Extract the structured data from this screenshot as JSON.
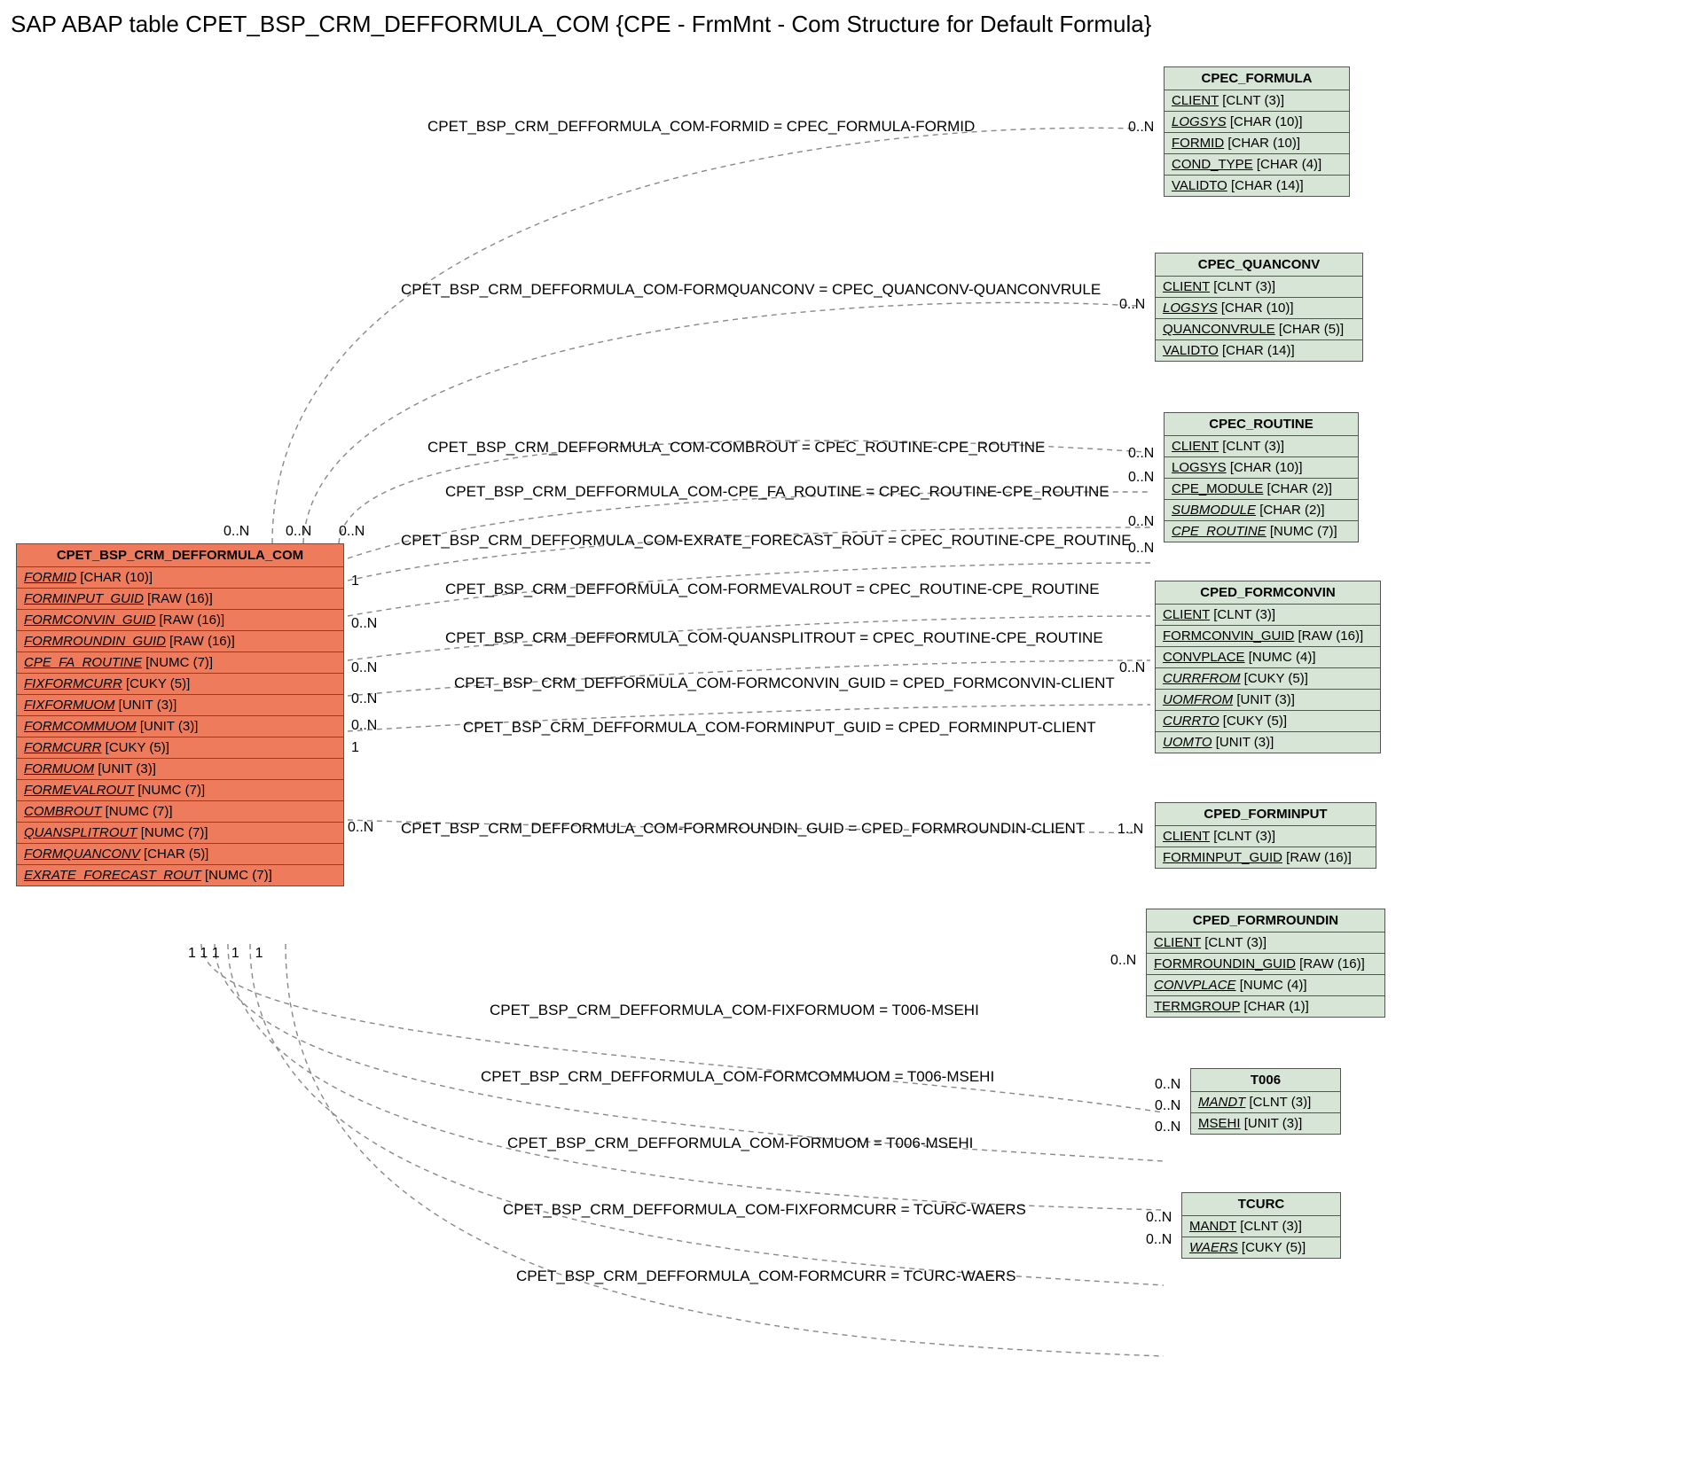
{
  "title": "SAP ABAP table CPET_BSP_CRM_DEFFORMULA_COM {CPE - FrmMnt - Com Structure for Default Formula}",
  "main_entity": {
    "name": "CPET_BSP_CRM_DEFFORMULA_COM",
    "fields": [
      {
        "name": "FORMID",
        "type": "[CHAR (10)]"
      },
      {
        "name": "FORMINPUT_GUID",
        "type": "[RAW (16)]"
      },
      {
        "name": "FORMCONVIN_GUID",
        "type": "[RAW (16)]"
      },
      {
        "name": "FORMROUNDIN_GUID",
        "type": "[RAW (16)]"
      },
      {
        "name": "CPE_FA_ROUTINE",
        "type": "[NUMC (7)]"
      },
      {
        "name": "FIXFORMCURR",
        "type": "[CUKY (5)]"
      },
      {
        "name": "FIXFORMUOM",
        "type": "[UNIT (3)]"
      },
      {
        "name": "FORMCOMMUOM",
        "type": "[UNIT (3)]"
      },
      {
        "name": "FORMCURR",
        "type": "[CUKY (5)]"
      },
      {
        "name": "FORMUOM",
        "type": "[UNIT (3)]"
      },
      {
        "name": "FORMEVALROUT",
        "type": "[NUMC (7)]"
      },
      {
        "name": "COMBROUT",
        "type": "[NUMC (7)]"
      },
      {
        "name": "QUANSPLITROUT",
        "type": "[NUMC (7)]"
      },
      {
        "name": "FORMQUANCONV",
        "type": "[CHAR (5)]"
      },
      {
        "name": "EXRATE_FORECAST_ROUT",
        "type": "[NUMC (7)]"
      }
    ]
  },
  "entities": {
    "cpec_formula": {
      "name": "CPEC_FORMULA",
      "fields": [
        {
          "name": "CLIENT",
          "type": "[CLNT (3)]",
          "italic": false
        },
        {
          "name": "LOGSYS",
          "type": "[CHAR (10)]",
          "italic": true
        },
        {
          "name": "FORMID",
          "type": "[CHAR (10)]",
          "italic": false
        },
        {
          "name": "COND_TYPE",
          "type": "[CHAR (4)]",
          "italic": false
        },
        {
          "name": "VALIDTO",
          "type": "[CHAR (14)]",
          "italic": false
        }
      ]
    },
    "cpec_quanconv": {
      "name": "CPEC_QUANCONV",
      "fields": [
        {
          "name": "CLIENT",
          "type": "[CLNT (3)]",
          "italic": false
        },
        {
          "name": "LOGSYS",
          "type": "[CHAR (10)]",
          "italic": true
        },
        {
          "name": "QUANCONVRULE",
          "type": "[CHAR (5)]",
          "italic": false
        },
        {
          "name": "VALIDTO",
          "type": "[CHAR (14)]",
          "italic": false
        }
      ]
    },
    "cpec_routine": {
      "name": "CPEC_ROUTINE",
      "fields": [
        {
          "name": "CLIENT",
          "type": "[CLNT (3)]",
          "italic": false
        },
        {
          "name": "LOGSYS",
          "type": "[CHAR (10)]",
          "italic": false
        },
        {
          "name": "CPE_MODULE",
          "type": "[CHAR (2)]",
          "italic": false
        },
        {
          "name": "SUBMODULE",
          "type": "[CHAR (2)]",
          "italic": true
        },
        {
          "name": "CPE_ROUTINE",
          "type": "[NUMC (7)]",
          "italic": true
        }
      ]
    },
    "cped_formconvin": {
      "name": "CPED_FORMCONVIN",
      "fields": [
        {
          "name": "CLIENT",
          "type": "[CLNT (3)]",
          "italic": false
        },
        {
          "name": "FORMCONVIN_GUID",
          "type": "[RAW (16)]",
          "italic": false
        },
        {
          "name": "CONVPLACE",
          "type": "[NUMC (4)]",
          "italic": false
        },
        {
          "name": "CURRFROM",
          "type": "[CUKY (5)]",
          "italic": true
        },
        {
          "name": "UOMFROM",
          "type": "[UNIT (3)]",
          "italic": true
        },
        {
          "name": "CURRTO",
          "type": "[CUKY (5)]",
          "italic": true
        },
        {
          "name": "UOMTO",
          "type": "[UNIT (3)]",
          "italic": true
        }
      ]
    },
    "cped_forminput": {
      "name": "CPED_FORMINPUT",
      "fields": [
        {
          "name": "CLIENT",
          "type": "[CLNT (3)]",
          "italic": false
        },
        {
          "name": "FORMINPUT_GUID",
          "type": "[RAW (16)]",
          "italic": false
        }
      ]
    },
    "cped_formroundin": {
      "name": "CPED_FORMROUNDIN",
      "fields": [
        {
          "name": "CLIENT",
          "type": "[CLNT (3)]",
          "italic": false
        },
        {
          "name": "FORMROUNDIN_GUID",
          "type": "[RAW (16)]",
          "italic": false
        },
        {
          "name": "CONVPLACE",
          "type": "[NUMC (4)]",
          "italic": true
        },
        {
          "name": "TERMGROUP",
          "type": "[CHAR (1)]",
          "italic": false
        }
      ]
    },
    "t006": {
      "name": "T006",
      "fields": [
        {
          "name": "MANDT",
          "type": "[CLNT (3)]",
          "italic": true
        },
        {
          "name": "MSEHI",
          "type": "[UNIT (3)]",
          "italic": false
        }
      ]
    },
    "tcurc": {
      "name": "TCURC",
      "fields": [
        {
          "name": "MANDT",
          "type": "[CLNT (3)]",
          "italic": false
        },
        {
          "name": "WAERS",
          "type": "[CUKY (5)]",
          "italic": true
        }
      ]
    }
  },
  "relations": {
    "r1": "CPET_BSP_CRM_DEFFORMULA_COM-FORMID = CPEC_FORMULA-FORMID",
    "r2": "CPET_BSP_CRM_DEFFORMULA_COM-FORMQUANCONV = CPEC_QUANCONV-QUANCONVRULE",
    "r3": "CPET_BSP_CRM_DEFFORMULA_COM-COMBROUT = CPEC_ROUTINE-CPE_ROUTINE",
    "r4": "CPET_BSP_CRM_DEFFORMULA_COM-CPE_FA_ROUTINE = CPEC_ROUTINE-CPE_ROUTINE",
    "r5": "CPET_BSP_CRM_DEFFORMULA_COM-EXRATE_FORECAST_ROUT = CPEC_ROUTINE-CPE_ROUTINE",
    "r6": "CPET_BSP_CRM_DEFFORMULA_COM-FORMEVALROUT = CPEC_ROUTINE-CPE_ROUTINE",
    "r7": "CPET_BSP_CRM_DEFFORMULA_COM-QUANSPLITROUT = CPEC_ROUTINE-CPE_ROUTINE",
    "r8": "CPET_BSP_CRM_DEFFORMULA_COM-FORMCONVIN_GUID = CPED_FORMCONVIN-CLIENT",
    "r9": "CPET_BSP_CRM_DEFFORMULA_COM-FORMINPUT_GUID = CPED_FORMINPUT-CLIENT",
    "r10": "CPET_BSP_CRM_DEFFORMULA_COM-FORMROUNDIN_GUID = CPED_FORMROUNDIN-CLIENT",
    "r11": "CPET_BSP_CRM_DEFFORMULA_COM-FIXFORMUOM = T006-MSEHI",
    "r12": "CPET_BSP_CRM_DEFFORMULA_COM-FORMCOMMUOM = T006-MSEHI",
    "r13": "CPET_BSP_CRM_DEFFORMULA_COM-FORMUOM = T006-MSEHI",
    "r14": "CPET_BSP_CRM_DEFFORMULA_COM-FIXFORMCURR = TCURC-WAERS",
    "r15": "CPET_BSP_CRM_DEFFORMULA_COM-FORMCURR = TCURC-WAERS"
  },
  "cards": {
    "c_top_left": "0..N",
    "c_top_mid": "0..N",
    "c_top_right_small": "0..N",
    "c_formula": "0..N",
    "c_quanconv": "0..N",
    "c_routine1": "0..N",
    "c_routine2": "0..N",
    "c_routine3": "0..N",
    "c_routine4": "0..N",
    "c_formconvin": "0..N",
    "c_forminput": "1..N",
    "c_formroundin": "0..N",
    "c_t006_1": "0..N",
    "c_t006_2": "0..N",
    "c_t006_3": "0..N",
    "c_tcurc_1": "0..N",
    "c_tcurc_2": "0..N",
    "c_main_1": "1",
    "c_main_0N_a": "0..N",
    "c_main_0N_b": "0..N",
    "c_main_0N_c": "0..N",
    "c_main_0N_d": "0..N",
    "c_main_1b": "1",
    "c_main_0N_e": "0..N",
    "c_bottom_ones": "1 1 1   1    1"
  }
}
